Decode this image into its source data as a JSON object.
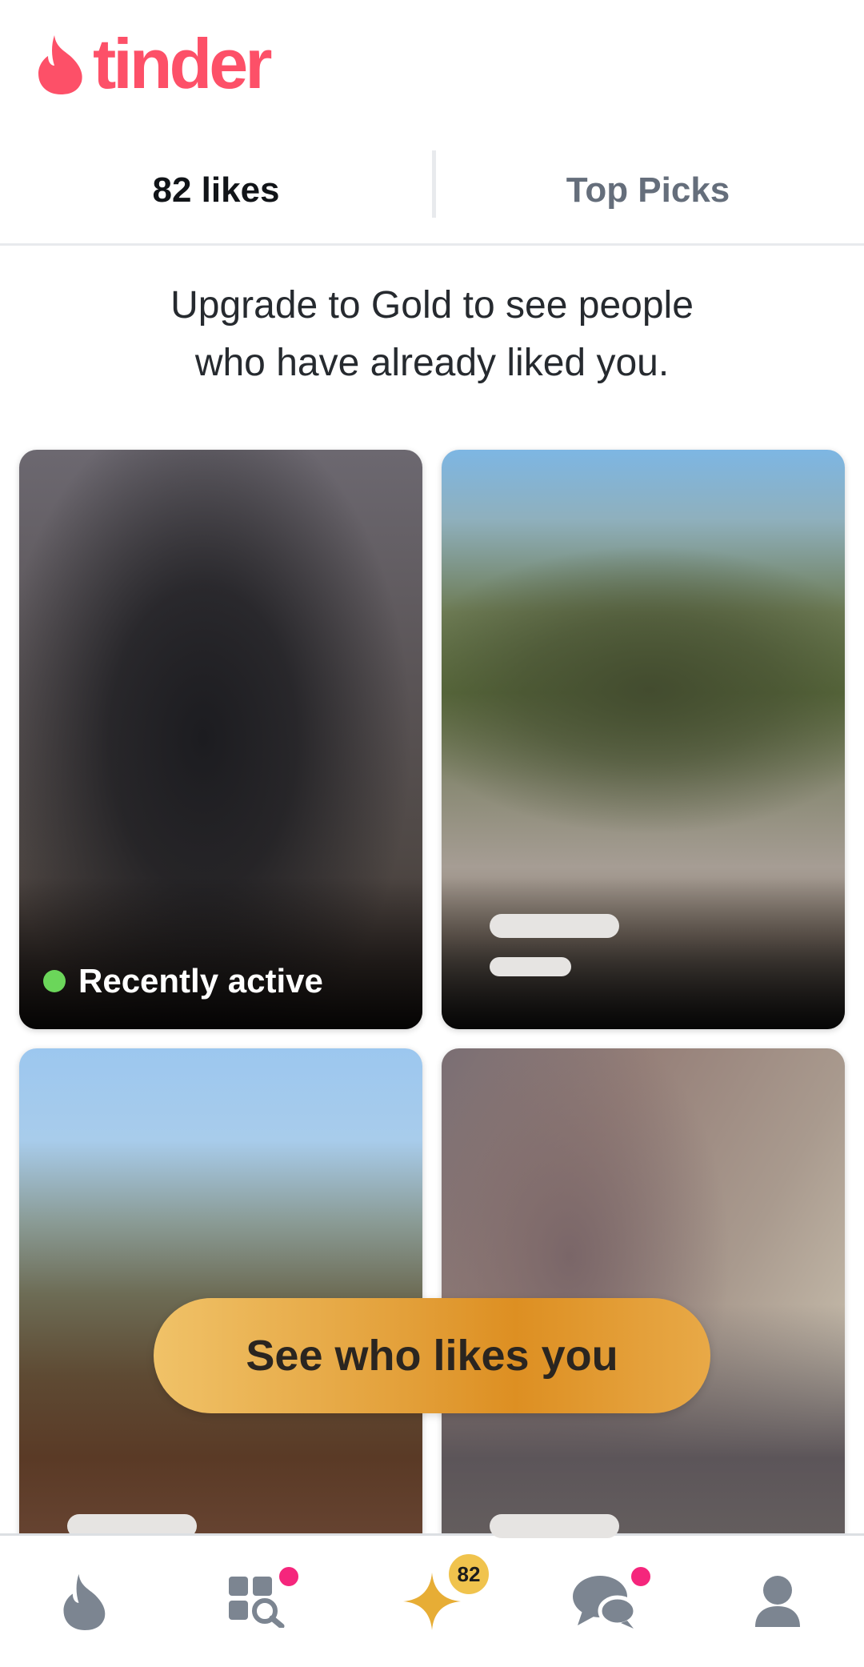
{
  "app": {
    "logo_text": "tinder"
  },
  "tabs": {
    "likes_label": "82 likes",
    "top_picks_label": "Top Picks"
  },
  "promo": {
    "line1": "Upgrade to Gold to see people",
    "line2": "who have already liked you."
  },
  "cards": [
    {
      "status": "Recently active"
    }
  ],
  "cta": {
    "label": "See who likes you"
  },
  "nav": {
    "likes_badge": "82",
    "items": [
      "flame-icon",
      "explore-icon",
      "likes-star-icon",
      "chat-icon",
      "profile-icon"
    ]
  },
  "colors": {
    "brand": "#fd5068",
    "gold": "#e3a03a",
    "active_green": "#6bd65a",
    "notification_pink": "#f5267c",
    "inactive_icon": "#7c8591"
  }
}
